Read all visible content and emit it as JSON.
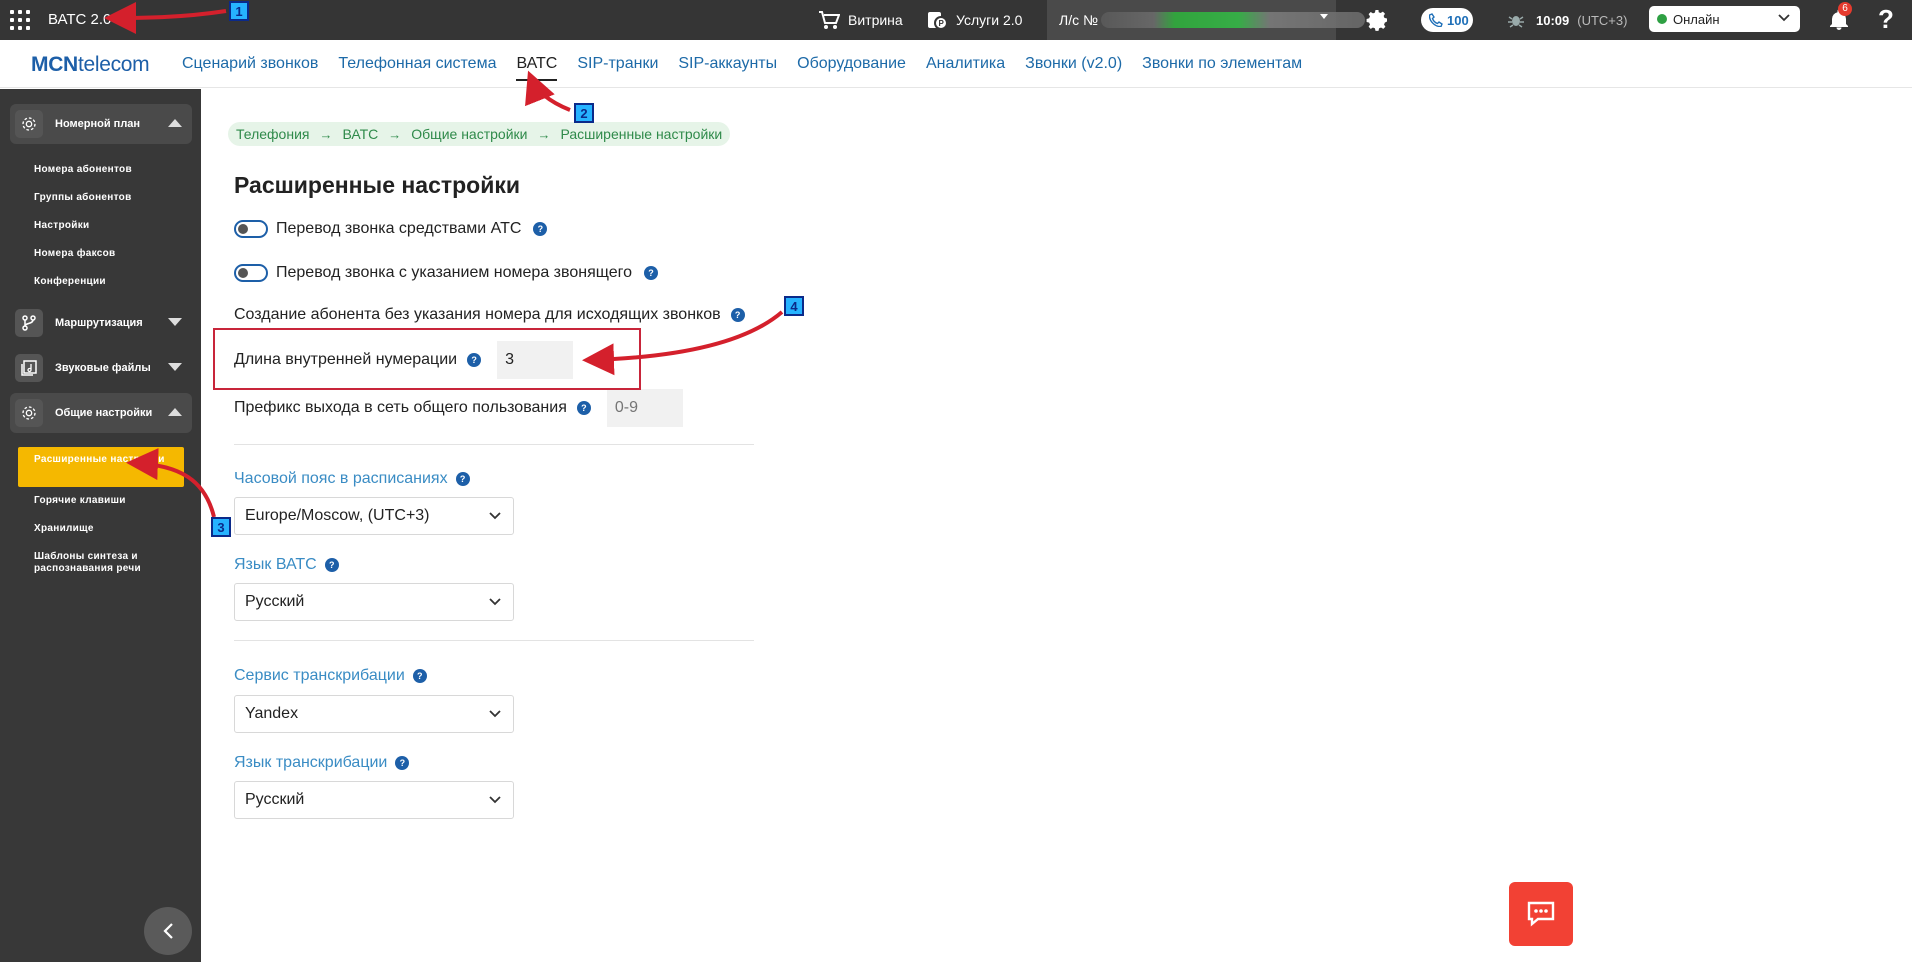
{
  "topbar": {
    "app_title": "ВАТС 2.0",
    "vitrina": "Витрина",
    "services": "Услуги 2.0",
    "account_label": "Л/с №",
    "calls_count": "100",
    "time": "10:09",
    "timezone": "(UTC+3)",
    "status_value": "Онлайн",
    "notifications_count": "6",
    "help": "?"
  },
  "navbar": {
    "logo_bold": "MCN",
    "logo_rest": "telecom",
    "links": [
      "Сценарий звонков",
      "Телефонная система",
      "ВАТС",
      "SIP-транки",
      "SIP-аккаунты",
      "Оборудование",
      "Аналитика",
      "Звонки (v2.0)",
      "Звонки по элементам"
    ]
  },
  "sidebar": {
    "sections": [
      "Номерной план",
      "Маршрутизация",
      "Звуковые файлы",
      "Общие настройки"
    ],
    "numbering_items": [
      "Номера абонентов",
      "Группы абонентов",
      "Настройки",
      "Номера факсов",
      "Конференции"
    ],
    "general_items": [
      "Расширенные настройки",
      "Горячие клавиши",
      "Хранилище",
      "Шаблоны синтеза и распознавания речи"
    ]
  },
  "breadcrumb": [
    "Телефония",
    "ВАТС",
    "Общие настройки",
    "Расширенные настройки"
  ],
  "breadcrumb_sep": "→",
  "page": {
    "title": "Расширенные настройки",
    "toggle_ats_transfer": "Перевод звонка средствами АТС",
    "toggle_caller_transfer": "Перевод звонка с указанием номера звонящего",
    "create_subscriber": "Создание абонента без указания номера для исходящих звонков",
    "internal_length_label": "Длина внутренней нумерации",
    "internal_length_value": "3",
    "prefix_label": "Префикс выхода в сеть общего пользования",
    "prefix_placeholder": "0-9",
    "timezone_label": "Часовой пояс в расписаниях",
    "timezone_value": "Europe/Moscow, (UTC+3)",
    "language_label": "Язык ВАТС",
    "language_value": "Русский",
    "transcription_label": "Сервис транскрибации",
    "transcription_value": "Yandex",
    "transcription_lang_label": "Язык транскрибации",
    "transcription_lang_value": "Русский",
    "help_mark": "?"
  },
  "annotations": [
    "1",
    "2",
    "3",
    "4"
  ],
  "colors": {
    "topbar_bg": "#353535",
    "sidebar_bg": "#383838",
    "link_blue": "#1d6aa8",
    "active_item": "#f5b800",
    "annotation_red": "#c8253a",
    "badge_blue": "#26b3ff",
    "chat_red": "#f24134"
  }
}
